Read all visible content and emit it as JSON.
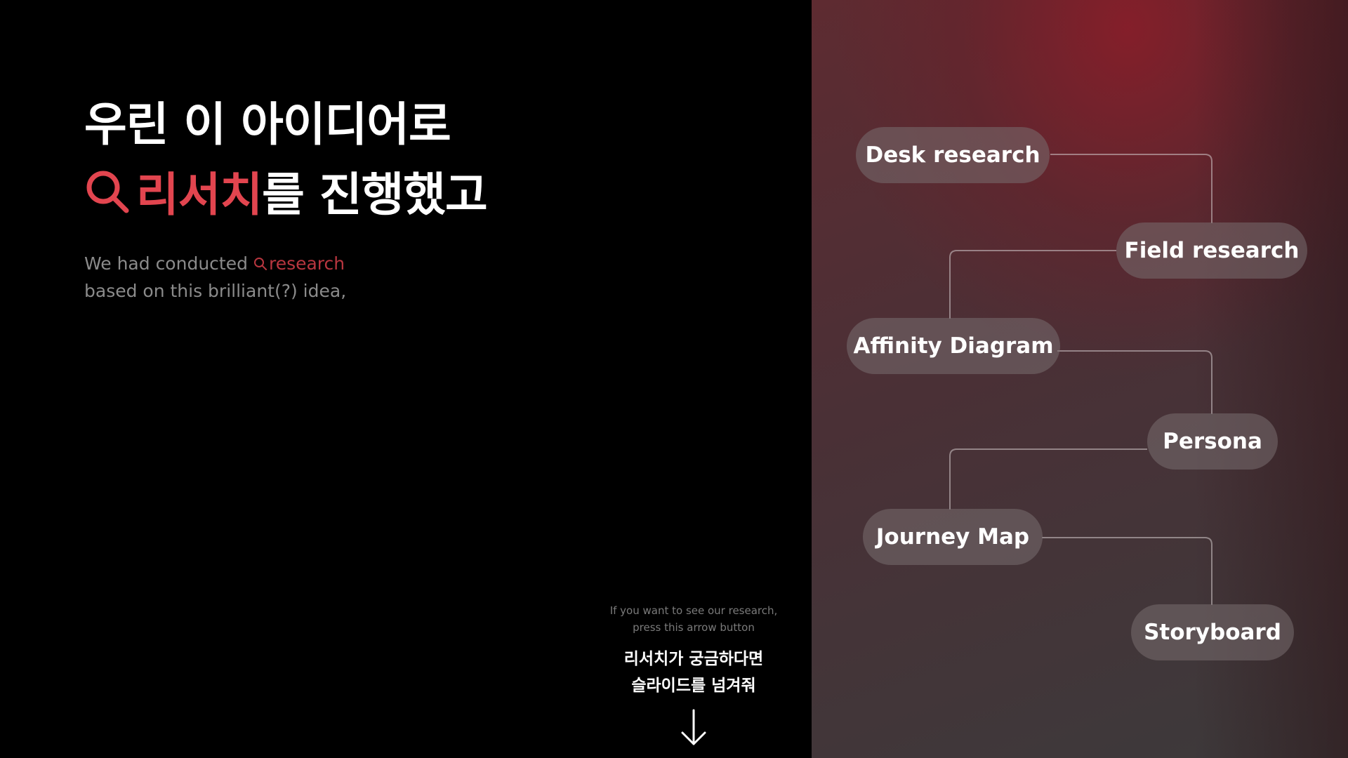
{
  "headline": {
    "line1": "우린 이 아이디어로",
    "line2_highlight": "리서치",
    "line2_rest": "를 진행했고",
    "highlight_color": "#e2454f"
  },
  "subtitle": {
    "line1_prefix": "We had conducted",
    "line1_highlight": "research",
    "line2": "based on this brilliant(?) idea,"
  },
  "hint": {
    "en_line1": "If you want to see our research,",
    "en_line2": "press this arrow button",
    "ko_line1": "리서치가 궁금하다면",
    "ko_line2": "슬라이드를 넘겨줘"
  },
  "icons": {
    "search": "magnifier-icon",
    "next": "arrow-down-icon"
  },
  "flow": {
    "steps": [
      "Desk research",
      "Field research",
      "Affinity Diagram",
      "Persona",
      "Journey Map",
      "Storyboard"
    ]
  }
}
